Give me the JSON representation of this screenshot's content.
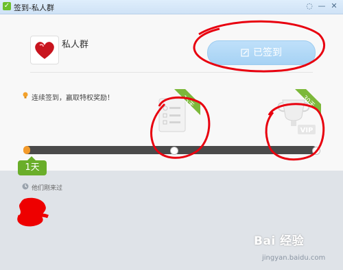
{
  "window": {
    "title": "签到-私人群"
  },
  "group": {
    "name": "私人群"
  },
  "checkin": {
    "button_label": "已签到"
  },
  "tip": {
    "text": "连续签到，赢取特权奖励！"
  },
  "rewards": [
    {
      "days_label": "15天",
      "icon": "checklist-card-icon"
    },
    {
      "days_label": "30天",
      "icon": "vip-cup-icon"
    }
  ],
  "progress": {
    "current_day_label": "1天",
    "current_day": 1,
    "max_day": 30
  },
  "past": {
    "text": "他们刚来过"
  },
  "watermark": {
    "brand": "Bai 经验",
    "url": "jingyan.baidu.com"
  },
  "colors": {
    "accent_orange": "#f39a2a",
    "badge_green": "#6aae2a",
    "button_blue": "#a6d2f4",
    "annotation_red": "#e8000f"
  }
}
